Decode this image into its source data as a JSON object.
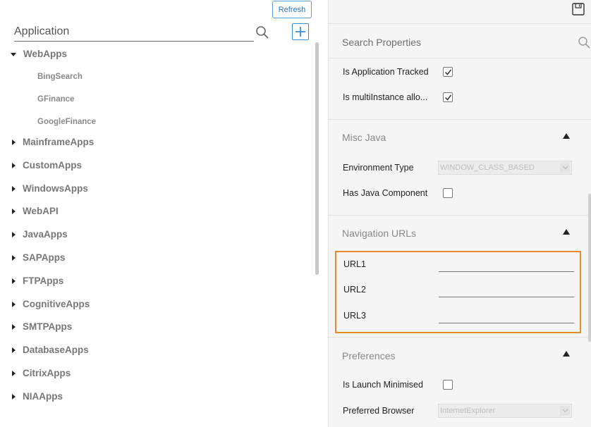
{
  "left": {
    "refresh_label": "Refresh",
    "application_placeholder": "Application",
    "tree": [
      {
        "label": "WebApps",
        "expanded": true,
        "children": [
          "BingSearch",
          "GFinance",
          "GoogleFinance"
        ]
      },
      {
        "label": "MainframeApps",
        "expanded": false
      },
      {
        "label": "CustomApps",
        "expanded": false
      },
      {
        "label": "WindowsApps",
        "expanded": false
      },
      {
        "label": "WebAPI",
        "expanded": false
      },
      {
        "label": "JavaApps",
        "expanded": false
      },
      {
        "label": "SAPApps",
        "expanded": false
      },
      {
        "label": "FTPApps",
        "expanded": false
      },
      {
        "label": "CognitiveApps",
        "expanded": false
      },
      {
        "label": "SMTPApps",
        "expanded": false
      },
      {
        "label": "DatabaseApps",
        "expanded": false
      },
      {
        "label": "CitrixApps",
        "expanded": false
      },
      {
        "label": "NIAApps",
        "expanded": false
      }
    ]
  },
  "right": {
    "search_placeholder": "Search Properties",
    "general": {
      "is_application_tracked_label": "Is Application Tracked",
      "is_application_tracked": true,
      "is_multiinstance_label": "Is multiInstance allo...",
      "is_multiinstance": true
    },
    "misc_java": {
      "title": "Misc Java",
      "environment_type_label": "Environment Type",
      "environment_type_value": "WINDOW_CLASS_BASED",
      "has_java_component_label": "Has Java Component",
      "has_java_component": false
    },
    "navigation_urls": {
      "title": "Navigation URLs",
      "url1_label": "URL1",
      "url1_value": "",
      "url2_label": "URL2",
      "url2_value": "",
      "url3_label": "URL3",
      "url3_value": ""
    },
    "preferences": {
      "title": "Preferences",
      "is_launch_minimised_label": "Is Launch Minimised",
      "is_launch_minimised": false,
      "preferred_browser_label": "Preferred Browser",
      "preferred_browser_value": "InternetExplorer"
    }
  },
  "colors": {
    "accent": "#3b8fd9",
    "highlight_border": "#e8892c",
    "panel_bg": "#f5f5f5"
  }
}
